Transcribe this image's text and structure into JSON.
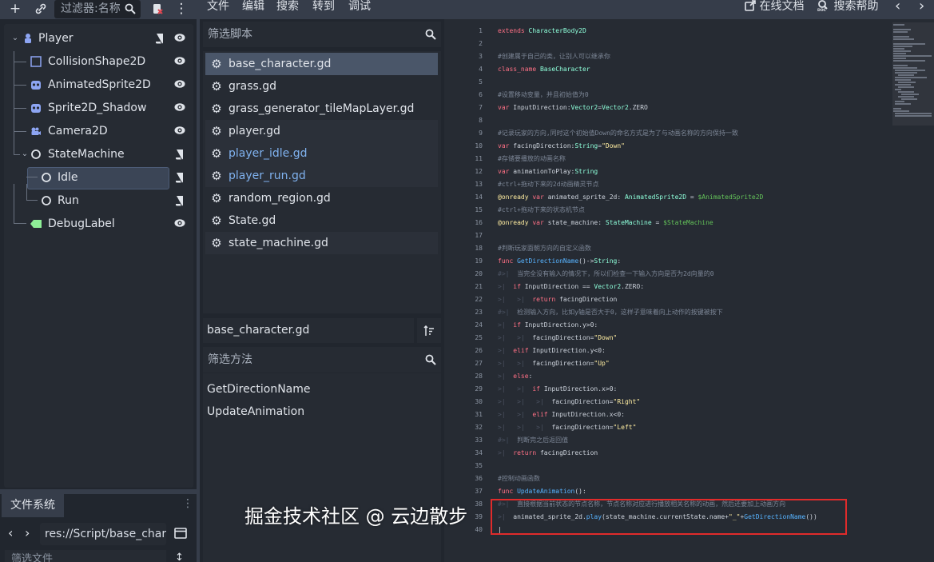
{
  "scene_dock": {
    "filter_placeholder": "过滤器:名称",
    "nodes": [
      {
        "label": "Player",
        "icon": "character-body-icon"
      },
      {
        "label": "CollisionShape2D",
        "icon": "collision-shape-icon"
      },
      {
        "label": "AnimatedSprite2D",
        "icon": "animated-sprite-icon"
      },
      {
        "label": "Sprite2D_Shadow",
        "icon": "sprite-icon"
      },
      {
        "label": "Camera2D",
        "icon": "camera-icon"
      },
      {
        "label": "StateMachine",
        "icon": "node-icon"
      },
      {
        "label": "Idle",
        "icon": "node-icon"
      },
      {
        "label": "Run",
        "icon": "node-icon"
      },
      {
        "label": "DebugLabel",
        "icon": "label-icon"
      }
    ]
  },
  "filesystem_dock": {
    "tab_label": "文件系统",
    "path": "res://Script/base_char",
    "filter_placeholder": "筛选文件"
  },
  "menu": {
    "items": [
      "文件",
      "编辑",
      "搜索",
      "转到",
      "调试"
    ],
    "online_docs": "在线文档",
    "search_help": "搜索帮助"
  },
  "script_panel": {
    "filter_placeholder": "筛选脚本",
    "scripts": [
      {
        "name": "base_character.gd",
        "state": "selected"
      },
      {
        "name": "grass.gd",
        "state": "normal"
      },
      {
        "name": "grass_generator_tileMapLayer.gd",
        "state": "normal"
      },
      {
        "name": "player.gd",
        "state": "bg"
      },
      {
        "name": "player_idle.gd",
        "state": "bg-blue"
      },
      {
        "name": "player_run.gd",
        "state": "bg-blue"
      },
      {
        "name": "random_region.gd",
        "state": "normal"
      },
      {
        "name": "State.gd",
        "state": "normal"
      },
      {
        "name": "state_machine.gd",
        "state": "bg"
      }
    ],
    "current_file": "base_character.gd",
    "method_filter_placeholder": "筛选方法",
    "methods": [
      "GetDirectionName",
      "UpdateAnimation"
    ]
  },
  "code_lines": [
    "1",
    "2",
    "3",
    "4",
    "5",
    "6",
    "7",
    "8",
    "9",
    "10",
    "11",
    "12",
    "13",
    "14",
    "15",
    "16",
    "17",
    "18",
    "19",
    "20",
    "21",
    "22",
    "23",
    "24",
    "25",
    "26",
    "27",
    "28",
    "29",
    "30",
    "31",
    "32",
    "33",
    "34",
    "35",
    "36",
    "37",
    "38",
    "39",
    "40"
  ],
  "code": {
    "l1_a": "extends ",
    "l1_b": "CharacterBody2D",
    "l3": "#创建属于自己的类，让别人可以继承你",
    "l4_a": "class_name ",
    "l4_b": "BaseCharacter",
    "l6": "#设置移动变量，并且初始值为0",
    "l7_a": "var ",
    "l7_b": "InputDirection:",
    "l7_c": "Vector2",
    "l7_d": "=",
    "l7_e": "Vector2",
    "l7_f": ".ZERO",
    "l9": "#记录玩家的方向,同时这个初始值Down的命名方式是为了与动画名称的方向保持一致",
    "l10_a": "var ",
    "l10_b": "facingDirection:",
    "l10_c": "String",
    "l10_d": "=",
    "l10_e": "\"Down\"",
    "l11": "#存储要播放的动画名称",
    "l12_a": "var ",
    "l12_b": "animationToPlay:",
    "l12_c": "String",
    "l13": "#ctrl+拖动下来的2d动画精灵节点",
    "l14_a": "@onready ",
    "l14_b": "var ",
    "l14_c": "animated_sprite_2d: ",
    "l14_d": "AnimatedSprite2D",
    "l14_e": " = ",
    "l14_f": "$AnimatedSprite2D",
    "l15": "#ctrl+拖动下来的状态机节点",
    "l16_a": "@onready ",
    "l16_b": "var ",
    "l16_c": "state_machine: ",
    "l16_d": "StateMachine",
    "l16_e": " = ",
    "l16_f": "$StateMachine",
    "l18": "#判断玩家面朝方向的自定义函数",
    "l19_a": "func ",
    "l19_b": "GetDirectionName",
    "l19_c": "()->",
    "l19_d": "String",
    "l19_e": ":",
    "l20": "当完全没有输入的情况下，所以们检查一下输入方向是否为2d向量的0",
    "l21_a": "if ",
    "l21_b": "InputDirection == ",
    "l21_c": "Vector2",
    "l21_d": ".ZERO:",
    "l22_a": "return ",
    "l22_b": "facingDirection",
    "l23": "检测输入方向，比如y轴是否大于0，这样子意味着向上动作的按键被按下",
    "l24_a": "if ",
    "l24_b": "InputDirection.y>0:",
    "l25_a": "facingDirection=",
    "l25_b": "\"Down\"",
    "l26_a": "elif ",
    "l26_b": "InputDirection.y<0:",
    "l27_a": "facingDirection=",
    "l27_b": "\"Up\"",
    "l28_a": "else",
    "l28_b": ":",
    "l29_a": "if ",
    "l29_b": "InputDirection.x>0:",
    "l30_a": "facingDirection=",
    "l30_b": "\"Right\"",
    "l31_a": "elif ",
    "l31_b": "InputDirection.x<0:",
    "l32_a": "facingDirection=",
    "l32_b": "\"Left\"",
    "l33": "判断完之后返回值",
    "l34_a": "return ",
    "l34_b": "facingDirection",
    "l36": "#控制动画函数",
    "l37_a": "func ",
    "l37_b": "UpdateAnimation",
    "l37_c": "():",
    "l38": "直接根据当前状态的节点名称，节点名称对应进行播放相关名称的动画，然后还要加上动画方向",
    "l39_a": "animated_sprite_2d.",
    "l39_b": "play",
    "l39_c": "(state_machine.currentState.name+",
    "l39_d": "\"_\"",
    "l39_e": "+",
    "l39_f": "GetDirectionName",
    "l39_g": "())"
  },
  "watermark": "掘金技术社区 @ 云边散步",
  "colors": {
    "keyword": "#ff7085",
    "type": "#8effda",
    "comment": "#7c8696",
    "function": "#57b3ff",
    "string": "#ffeda1",
    "node_path": "#63c259",
    "highlight_box": "#e02b2b"
  }
}
